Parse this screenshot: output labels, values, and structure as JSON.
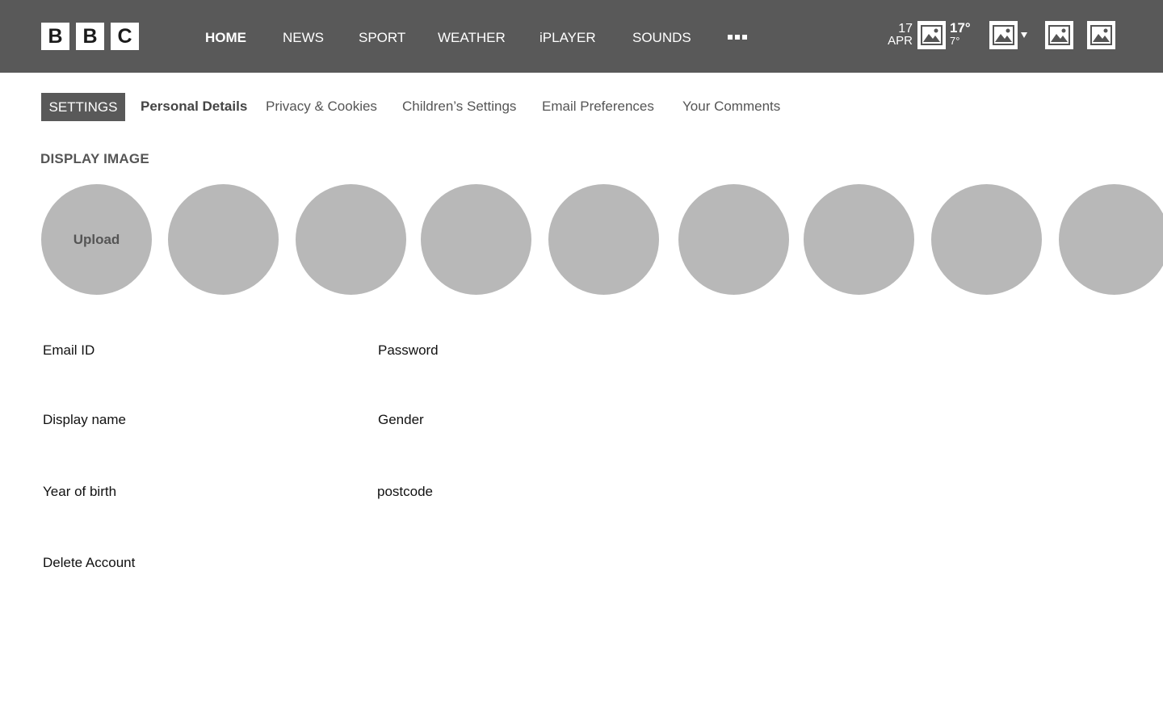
{
  "header": {
    "logo_letters": [
      "B",
      "B",
      "C"
    ],
    "nav": [
      {
        "label": "HOME",
        "active": true
      },
      {
        "label": "NEWS"
      },
      {
        "label": "SPORT"
      },
      {
        "label": "WEATHER"
      },
      {
        "label": "iPLAYER"
      },
      {
        "label": "SOUNDS"
      }
    ],
    "more_icon": "more-dots-icon",
    "date": {
      "day": "17",
      "month": "APR"
    },
    "weather": {
      "high": "17°",
      "low": "7°"
    },
    "icons": [
      "image-icon",
      "image-icon",
      "image-icon",
      "image-icon"
    ],
    "colors": {
      "bar": "#595959",
      "text": "#ffffff"
    }
  },
  "subnav": {
    "badge": "SETTINGS",
    "items": [
      {
        "label": "Personal Details",
        "active": true
      },
      {
        "label": "Privacy & Cookies"
      },
      {
        "label": "Children’s Settings"
      },
      {
        "label": "Email Preferences"
      },
      {
        "label": "Your Comments"
      }
    ]
  },
  "display_image": {
    "title": "DISPLAY IMAGE",
    "upload_label": "Upload",
    "avatar_color": "#b8b8b8"
  },
  "fields": {
    "email": "Email ID",
    "password": "Password",
    "display_name": "Display name",
    "gender": "Gender",
    "year_of_birth": "Year of birth",
    "postcode": "postcode",
    "delete_account": "Delete Account"
  }
}
